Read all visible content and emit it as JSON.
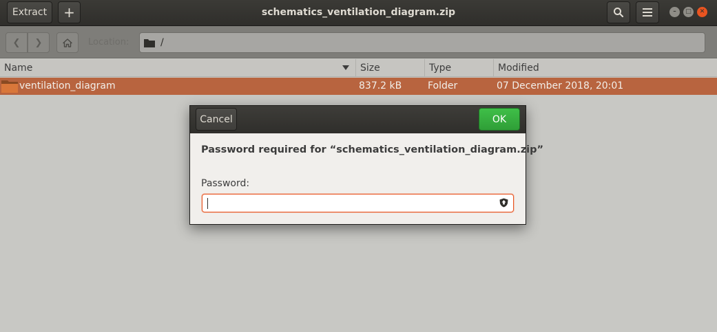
{
  "window": {
    "title": "schematics_ventilation_diagram.zip",
    "extract_label": "Extract",
    "add_label": "+"
  },
  "icons": {
    "search": "search-icon",
    "menu": "hamburger-menu-icon",
    "minimize": "minimize-icon",
    "maximize": "maximize-icon",
    "close": "close-icon",
    "back": "back-arrow-icon",
    "forward": "forward-arrow-icon",
    "home": "home-icon",
    "folder": "folder-icon",
    "caps_lock": "caps-lock-warning-icon"
  },
  "location": {
    "label": "Location:",
    "path": "/"
  },
  "columns": [
    "Name",
    "Size",
    "Type",
    "Modified"
  ],
  "files": [
    {
      "name": "ventilation_diagram",
      "size": "837.2 kB",
      "type": "Folder",
      "modified": "07 December 2018, 20:01"
    }
  ],
  "dialog": {
    "cancel_label": "Cancel",
    "ok_label": "OK",
    "prompt": "Password required for “schematics_ventilation_diagram.zip”",
    "password_label": "Password:",
    "password_value": ""
  },
  "colors": {
    "accent": "#e95420",
    "ok_green": "#3fbf48",
    "selection": "#b8643f"
  }
}
